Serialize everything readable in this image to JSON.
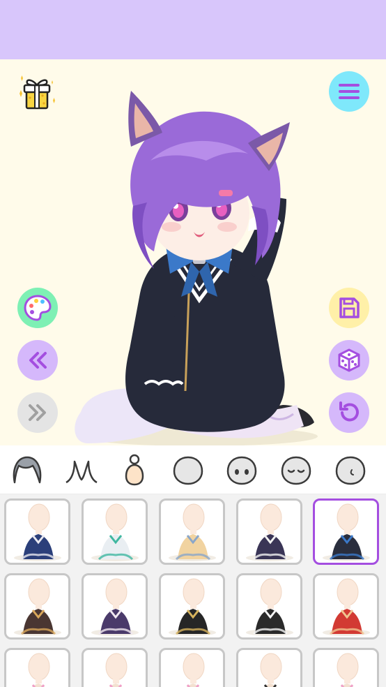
{
  "app": {
    "screen": "character-dress-up",
    "colors": {
      "header": "#d8c6fb",
      "stage_background": "#fffbea",
      "button_purple": "#d5b8fb",
      "button_green": "#7ef0b4",
      "button_yellow": "#fff0a8",
      "button_cyan": "#7fe8fb",
      "button_gray": "#e4e4e4",
      "selected_border": "#a44ee0",
      "tile_border": "#c7c7c7"
    }
  },
  "toolbar_left": [
    {
      "name": "palette-button",
      "icon": "palette-icon"
    },
    {
      "name": "previous-button",
      "icon": "double-chevron-left-icon"
    },
    {
      "name": "next-button",
      "icon": "double-chevron-right-icon",
      "disabled": true
    }
  ],
  "toolbar_right": [
    {
      "name": "menu-button",
      "icon": "hamburger-menu-icon"
    },
    {
      "name": "save-button",
      "icon": "floppy-disk-icon"
    },
    {
      "name": "random-button",
      "icon": "dice-icon"
    },
    {
      "name": "reset-button",
      "icon": "undo-icon"
    }
  ],
  "gift": {
    "icon": "gift-box-icon"
  },
  "categories": [
    {
      "name": "hair",
      "icon": "hair-icon",
      "selected": false
    },
    {
      "name": "ears",
      "icon": "animal-ears-icon",
      "selected": false
    },
    {
      "name": "body",
      "icon": "body-icon",
      "selected": true
    },
    {
      "name": "face-shape",
      "icon": "head-icon",
      "selected": false
    },
    {
      "name": "eyes",
      "icon": "eyes-face-icon",
      "selected": false
    },
    {
      "name": "expression",
      "icon": "closed-eyes-face-icon",
      "selected": false
    },
    {
      "name": "side-face",
      "icon": "side-face-icon",
      "selected": false
    }
  ],
  "outfits": [
    {
      "name": "sailor-uniform",
      "color": "#2b3f7a",
      "accent": "#e8e8f0",
      "locked": false,
      "selected": false
    },
    {
      "name": "white-sailor-dress",
      "color": "#e9eef2",
      "accent": "#3fb7a0",
      "locked": false,
      "selected": false
    },
    {
      "name": "beige-cardigan",
      "color": "#f1d3a0",
      "accent": "#8aa6c9",
      "locked": false,
      "selected": false
    },
    {
      "name": "maid-dress",
      "color": "#3a3556",
      "accent": "#f2f2f2",
      "locked": false,
      "selected": false
    },
    {
      "name": "black-school-uniform",
      "color": "#2a2e3d",
      "accent": "#3b79c9",
      "locked": false,
      "selected": true
    },
    {
      "name": "brown-corset-dress",
      "color": "#4a3632",
      "accent": "#d9a75a",
      "locked": false,
      "selected": false
    },
    {
      "name": "purple-off-shoulder",
      "color": "#4a3a6a",
      "accent": "#f0e8f0",
      "locked": false,
      "selected": false
    },
    {
      "name": "black-slip-dress",
      "color": "#262626",
      "accent": "#d7b35d",
      "locked": false,
      "selected": false
    },
    {
      "name": "black-corset-white-blouse",
      "color": "#2a2a2a",
      "accent": "#f5f5f5",
      "locked": false,
      "selected": false
    },
    {
      "name": "red-kimono",
      "color": "#d23a33",
      "accent": "#f0c48f",
      "locked": false,
      "selected": false
    },
    {
      "name": "locked-outfit-1",
      "color": "#f3e0d0",
      "accent": "#f0a0c8",
      "locked": true,
      "selected": false
    },
    {
      "name": "locked-outfit-2",
      "color": "#f3e0d0",
      "accent": "#f0a0c8",
      "locked": true,
      "selected": false
    },
    {
      "name": "locked-outfit-3",
      "color": "#f3e0d0",
      "accent": "#f0a0c8",
      "locked": true,
      "selected": false
    },
    {
      "name": "back-view-outfit",
      "color": "#f3e0d0",
      "accent": "#333333",
      "locked": false,
      "selected": false
    },
    {
      "name": "locked-outfit-4",
      "color": "#f3e0d0",
      "accent": "#f0a0c8",
      "locked": true,
      "selected": false
    }
  ]
}
